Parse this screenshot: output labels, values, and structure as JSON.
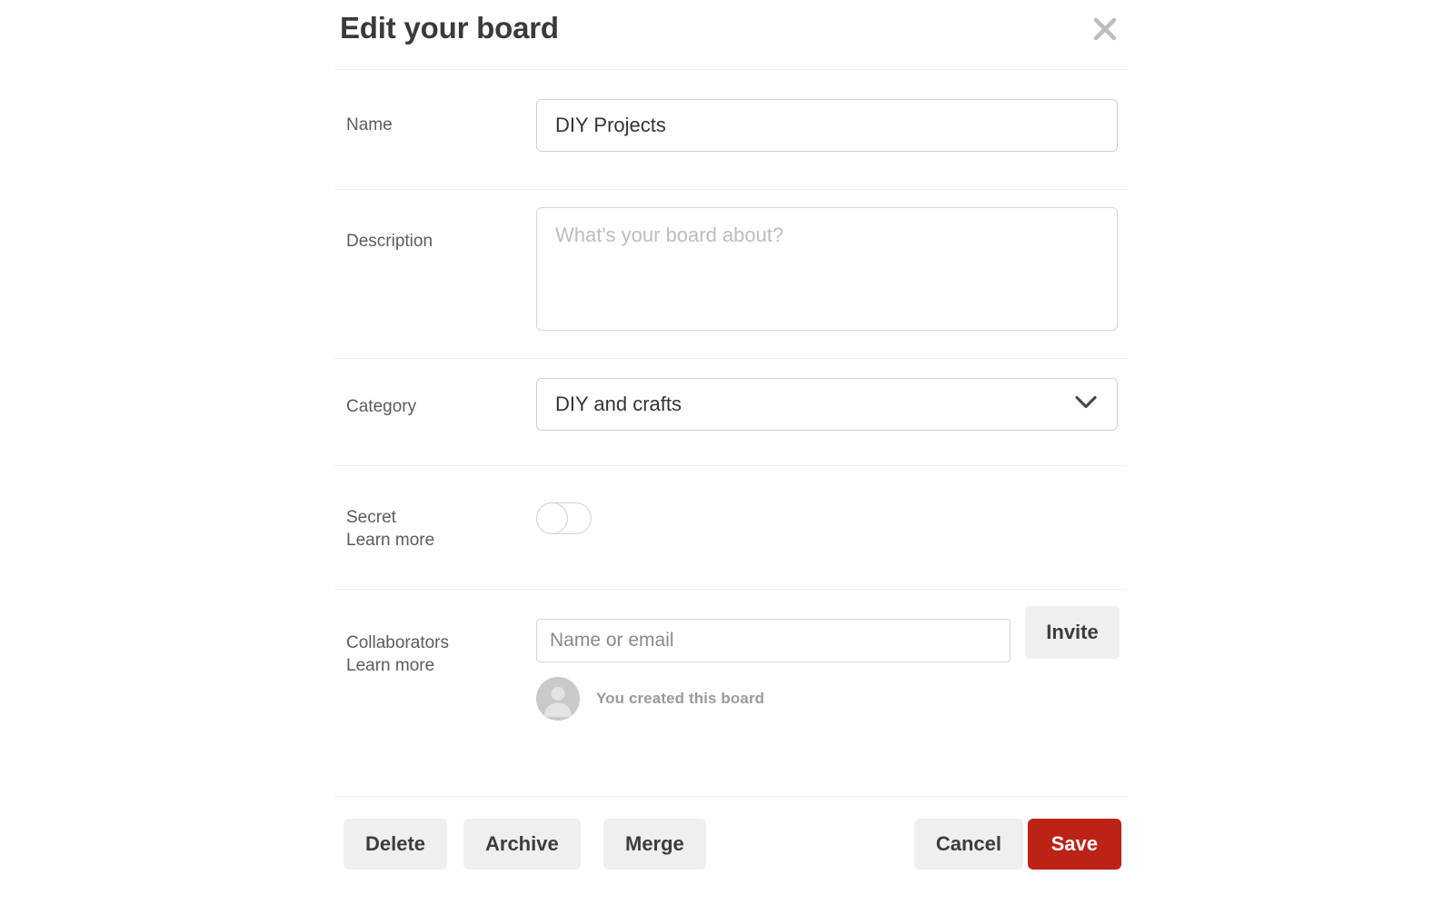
{
  "dialog": {
    "title": "Edit your board",
    "close_icon": "close-icon"
  },
  "fields": {
    "name": {
      "label": "Name",
      "value": "DIY Projects",
      "placeholder": ""
    },
    "description": {
      "label": "Description",
      "value": "",
      "placeholder": "What's your board about?"
    },
    "category": {
      "label": "Category",
      "selected": "DIY and crafts",
      "chevron_icon": "chevron-down-icon"
    },
    "secret": {
      "label": "Secret",
      "learn_more": "Learn more",
      "state": "off"
    },
    "collaborators": {
      "label": "Collaborators",
      "learn_more": "Learn more",
      "input_value": "",
      "input_placeholder": "Name or email",
      "invite_label": "Invite",
      "entries": [
        {
          "avatar_icon": "avatar-icon",
          "text": "You created this board"
        }
      ]
    }
  },
  "footer": {
    "delete_label": "Delete",
    "archive_label": "Archive",
    "merge_label": "Merge",
    "cancel_label": "Cancel",
    "save_label": "Save"
  },
  "colors": {
    "save_red": "#bd2217",
    "button_gray": "#efefef",
    "label_gray": "#5c5c5c",
    "border_gray": "#cfcfcf"
  }
}
